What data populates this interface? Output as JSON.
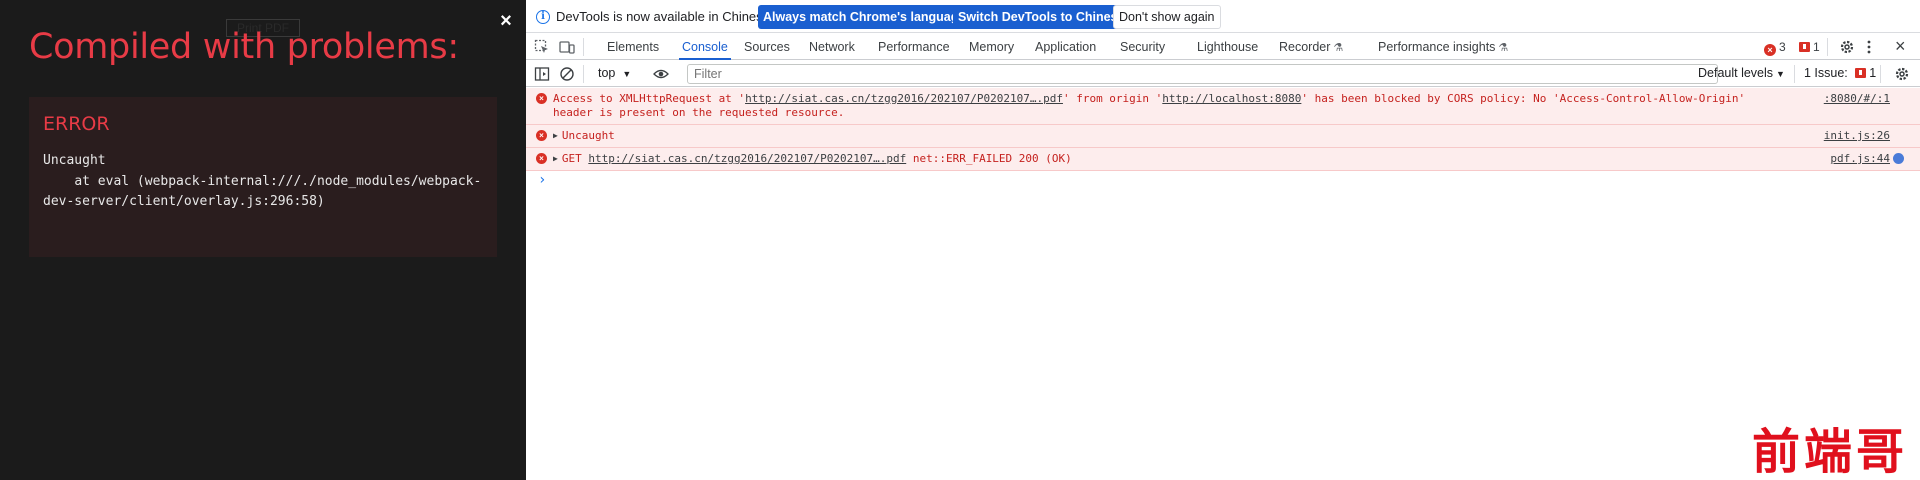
{
  "overlay": {
    "print_button": "Print PDF",
    "close": "×",
    "title": "Compiled with problems:",
    "error_heading": "ERROR",
    "error_message": "Uncaught\n    at eval (webpack-internal:///./node_modules/webpack-dev-server/client/overlay.js:296:58)"
  },
  "infobar": {
    "text": "DevTools is now available in Chinese!",
    "btn_match": "Always match Chrome's language",
    "btn_switch": "Switch DevTools to Chinese",
    "btn_dismiss": "Don't show again"
  },
  "tabs": [
    "Elements",
    "Console",
    "Sources",
    "Network",
    "Performance",
    "Memory",
    "Application",
    "Security",
    "Lighthouse",
    "Recorder",
    "Performance insights"
  ],
  "active_tab": "Console",
  "counts": {
    "errors": "3",
    "issues_flag": "1",
    "close": "×"
  },
  "filterbar": {
    "context": "top",
    "filter_placeholder": "Filter",
    "levels": "Default levels",
    "issues_label": "1 Issue:",
    "issues_count": "1"
  },
  "console": {
    "messages": [
      {
        "pre": "Access to XMLHttpRequest at '",
        "url": "http://siat.cas.cn/tzgg2016/202107/P0202107….pdf",
        "mid": "' from origin '",
        "origin": "http://localhost:8080",
        "post": "' has been blocked by CORS policy: No 'Access-Control-Allow-Origin' header is present on the requested resource.",
        "source": ":8080/#/:1"
      },
      {
        "text": "Uncaught",
        "source": "init.js:26"
      },
      {
        "pre": "GET ",
        "url": "http://siat.cas.cn/tzgg2016/202107/P0202107….pdf",
        "post": " net::ERR_FAILED 200 (OK)",
        "source": "pdf.js:44"
      }
    ],
    "prompt": "›"
  },
  "watermark": "前端哥",
  "colors": {
    "accent": "#1a5fd0",
    "error": "#d93025",
    "overlay_bg": "#1b1b1b",
    "overlay_title": "#e83b46"
  }
}
